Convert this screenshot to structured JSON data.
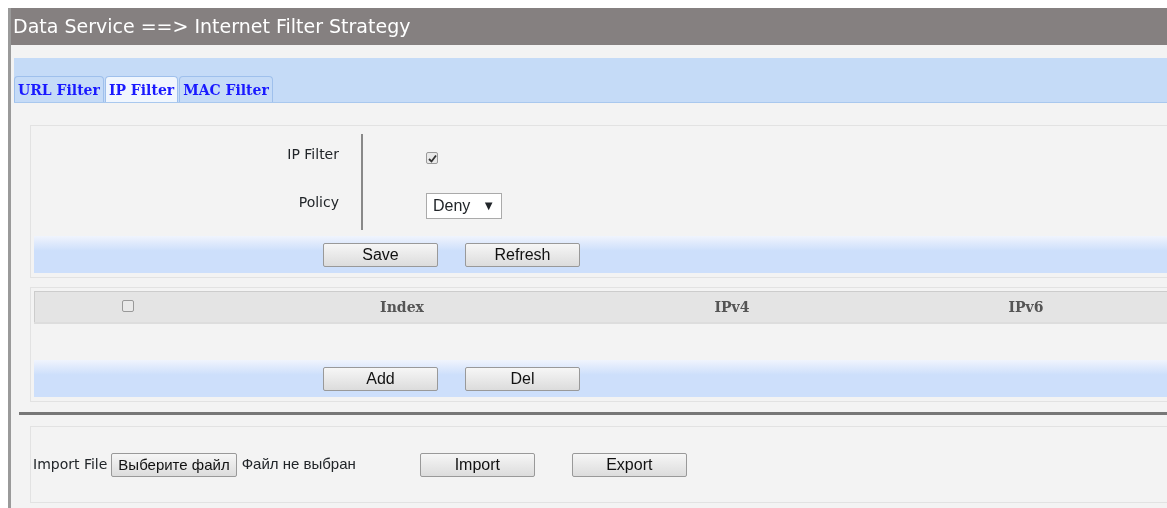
{
  "title": "Data Service ==> Internet Filter Strategy",
  "tabs": [
    {
      "label": "URL Filter",
      "selected": false
    },
    {
      "label": "IP Filter",
      "selected": true
    },
    {
      "label": "MAC Filter",
      "selected": false
    }
  ],
  "settings": {
    "fields": [
      {
        "kind": "checkbox",
        "label": "IP Filter",
        "checked": true
      },
      {
        "kind": "select",
        "label": "Policy",
        "value": "Deny",
        "arrow": "▼"
      }
    ],
    "buttons": [
      "Save",
      "Refresh"
    ]
  },
  "table": {
    "select_all": {
      "checked": false
    },
    "columns": [
      "Index",
      "IPv4",
      "IPv6"
    ],
    "buttons": [
      "Add",
      "Del"
    ]
  },
  "import": {
    "label": "Import File",
    "file_button": "Выберите файл",
    "file_status": "Файл не выбран",
    "buttons": [
      "Import",
      "Export"
    ]
  }
}
